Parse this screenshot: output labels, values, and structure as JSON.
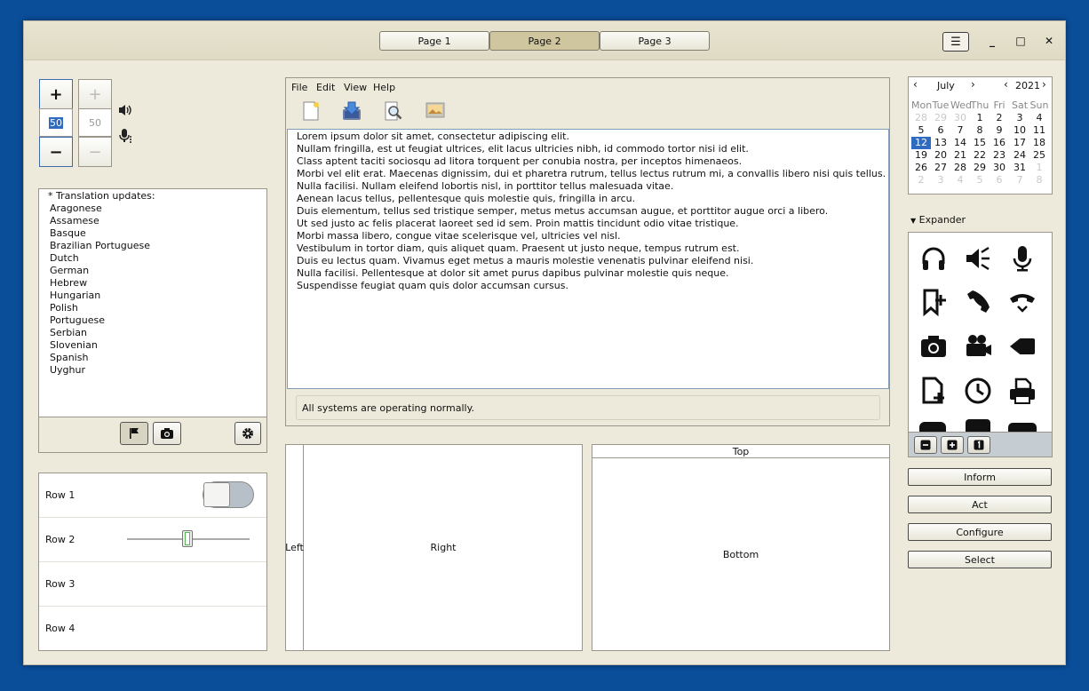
{
  "tabs": [
    "Page 1",
    "Page 2",
    "Page 3"
  ],
  "window_controls": {
    "menu": "☰",
    "minimize": "_",
    "maximize": "□",
    "close": "✕"
  },
  "spinners": {
    "plus": "+",
    "minus": "−",
    "value_active": "50",
    "value_disabled": "50"
  },
  "translations": {
    "header": "* Translation updates:",
    "items": [
      "Aragonese",
      "Assamese",
      "Basque",
      "Brazilian Portuguese",
      "Dutch",
      "German",
      "Hebrew",
      "Hungarian",
      "Polish",
      "Portuguese",
      "Serbian",
      "Slovenian",
      "Spanish",
      "Uyghur"
    ]
  },
  "rows": [
    "Row 1",
    "Row 2",
    "Row 3",
    "Row 4"
  ],
  "row2_slider_level": 0.49,
  "menubar": [
    "File",
    "Edit",
    "View",
    "Help"
  ],
  "text_lines": [
    "Lorem ipsum dolor sit amet, consectetur adipiscing elit.",
    "Nullam fringilla, est ut feugiat ultrices, elit lacus ultricies nibh, id commodo tortor nisi id elit.",
    "Class aptent taciti sociosqu ad litora torquent per conubia nostra, per inceptos himenaeos.",
    "Morbi vel elit erat. Maecenas dignissim, dui et pharetra rutrum, tellus lectus rutrum mi, a convallis libero nisi quis tellus.",
    "Nulla facilisi. Nullam eleifend lobortis nisl, in porttitor tellus malesuada vitae.",
    "Aenean lacus tellus, pellentesque quis molestie quis, fringilla in arcu.",
    "Duis elementum, tellus sed tristique semper, metus metus accumsan augue, et porttitor augue orci a libero.",
    "Ut sed justo ac felis placerat laoreet sed id sem. Proin mattis tincidunt odio vitae tristique.",
    "Morbi massa libero, congue vitae scelerisque vel, ultricies vel nisl.",
    "Vestibulum in tortor diam, quis aliquet quam. Praesent ut justo neque, tempus rutrum est.",
    "Duis eu lectus quam. Vivamus eget metus a mauris molestie venenatis pulvinar eleifend nisi.",
    "Nulla facilisi. Pellentesque at dolor sit amet purus dapibus pulvinar molestie quis neque.",
    "Suspendisse feugiat quam quis dolor accumsan cursus."
  ],
  "status": "All systems are operating normally.",
  "pane_labels": {
    "left": "Left",
    "right": "Right",
    "top": "Top",
    "bottom": "Bottom"
  },
  "calendar": {
    "month": "July",
    "year": "2021",
    "weekdays": [
      "Mon",
      "Tue",
      "Wed",
      "Thu",
      "Fri",
      "Sat",
      "Sun"
    ],
    "weeks": [
      [
        "28",
        "29",
        "30",
        "1",
        "2",
        "3",
        "4"
      ],
      [
        "5",
        "6",
        "7",
        "8",
        "9",
        "10",
        "11"
      ],
      [
        "12",
        "13",
        "14",
        "15",
        "16",
        "17",
        "18"
      ],
      [
        "19",
        "20",
        "21",
        "22",
        "23",
        "24",
        "25"
      ],
      [
        "26",
        "27",
        "28",
        "29",
        "30",
        "31",
        "1"
      ],
      [
        "2",
        "3",
        "4",
        "5",
        "6",
        "7",
        "8"
      ]
    ],
    "selected": "12"
  },
  "expander_label": "Expander",
  "icon_grid": [
    "headphones-icon",
    "speaker-mute-icon",
    "microphone-icon",
    "bookmark-add-icon",
    "phone-icon",
    "hang-up-icon",
    "camera-icon",
    "video-camera-icon",
    "video-icon",
    "document-add-icon",
    "clock-icon",
    "printer-icon"
  ],
  "action_buttons": [
    "Inform",
    "Act",
    "Configure",
    "Select"
  ],
  "colors": {
    "accent": "#2f6bc1",
    "background": "#0a4e9a",
    "window": "#edeadb"
  }
}
